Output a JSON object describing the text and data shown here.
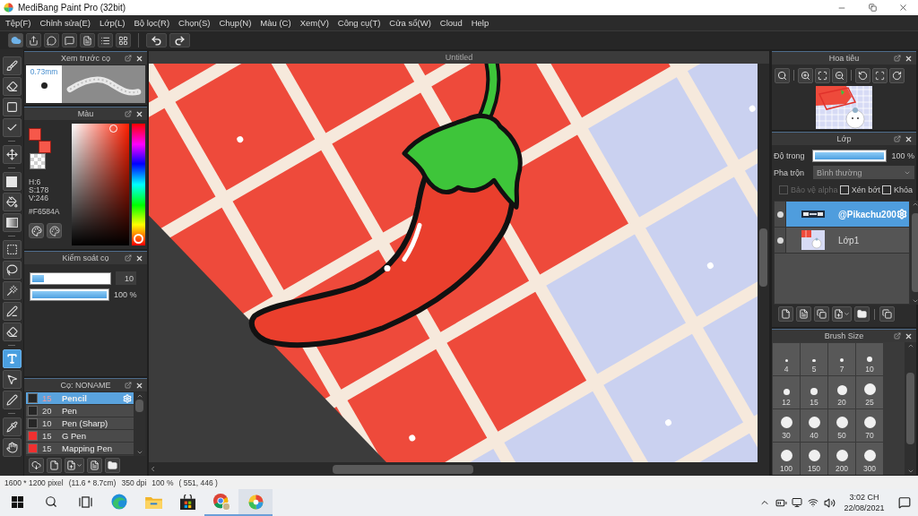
{
  "window": {
    "title": "MediBang Paint Pro (32bit)"
  },
  "menu": [
    "Tệp(F)",
    "Chỉnh sửa(E)",
    "Lớp(L)",
    "Bộ lọc(R)",
    "Chọn(S)",
    "Chụp(N)",
    "Màu (C)",
    "Xem(V)",
    "Công cụ(T)",
    "Cửa sổ(W)",
    "Cloud",
    "Help"
  ],
  "tool_groups": [
    {
      "tools": [
        {
          "selected": false
        },
        {
          "selected": false
        },
        {
          "selected": false
        },
        {
          "selected": false
        }
      ]
    },
    {
      "tools": [
        {
          "selected": false
        }
      ]
    },
    {
      "tools": [
        {
          "selected": false
        },
        {
          "selected": false
        },
        {
          "selected": false
        }
      ]
    },
    {
      "tools": [
        {
          "selected": false
        },
        {
          "selected": false
        },
        {
          "selected": false
        },
        {
          "selected": false
        },
        {
          "selected": false
        }
      ]
    },
    {
      "tools": [
        {
          "selected": true
        },
        {
          "selected": false
        },
        {
          "selected": false
        }
      ]
    },
    {
      "tools": [
        {
          "selected": false
        },
        {
          "selected": false
        }
      ]
    }
  ],
  "brush_preview": {
    "title": "Xem trước cọ",
    "size": "0.73mm"
  },
  "color_panel": {
    "title": "Màu",
    "swatches": [
      {
        "color": "#f6584a"
      },
      {
        "color": "#f6584a"
      }
    ],
    "hsv": [
      "H:6",
      "S:178",
      "V:246"
    ],
    "hex": "#F6584A",
    "hue": {
      "level": 0.02
    }
  },
  "brush_control": {
    "title": "Kiểm soát cọ",
    "sliders": [
      {
        "kind": "boxed",
        "level": 0.15,
        "reading": "10"
      },
      {
        "kind": "plain",
        "level": 1,
        "reading": "100 %"
      }
    ]
  },
  "brush_list": {
    "title": "Cọ: NONAME",
    "items": [
      {
        "color": "#262626",
        "size": "15",
        "name": "Pencil",
        "selected": true
      },
      {
        "color": "#262626",
        "size": "20",
        "name": "Pen",
        "selected": false
      },
      {
        "color": "#262626",
        "size": "10",
        "name": "Pen (Sharp)",
        "selected": false
      },
      {
        "color": "#f03030",
        "size": "15",
        "name": "G Pen",
        "selected": false
      },
      {
        "color": "#f03030",
        "size": "15",
        "name": "Mapping Pen",
        "selected": false
      }
    ]
  },
  "canvas": {
    "tab": "Untitled"
  },
  "navigator": {
    "title": "Hoa tiêu"
  },
  "layers": {
    "title": "Lớp",
    "opacity": {
      "label": "Độ trong",
      "level": 1,
      "reading": "100 %"
    },
    "blend": {
      "label": "Pha trộn",
      "value": "Bình thường"
    },
    "options": [
      {
        "label": "Bảo vệ alpha",
        "checked": false,
        "disabled": true
      },
      {
        "label": "Xén bớt",
        "checked": false,
        "disabled": false
      },
      {
        "label": "Khóa",
        "checked": false,
        "disabled": false
      }
    ],
    "items": [
      {
        "kind": "text",
        "name": "@Pikachu200",
        "selected": true,
        "visible": true
      },
      {
        "kind": "image",
        "name": "Lớp1",
        "selected": false,
        "visible": true
      }
    ]
  },
  "brush_size": {
    "title": "Brush Size",
    "sizes": [
      "4",
      "5",
      "7",
      "10",
      "12",
      "15",
      "20",
      "25",
      "30",
      "40",
      "50",
      "70",
      "100",
      "150",
      "200",
      "300"
    ]
  },
  "status_bar": [
    "1600 * 1200 pixel",
    "(11.6 * 8.7cm)",
    "350 dpi",
    "100 %",
    "( 551, 446 )"
  ],
  "taskbar": {
    "apps": [
      {
        "running": false,
        "selected": false
      },
      {
        "running": false,
        "selected": false
      },
      {
        "running": false,
        "selected": false
      },
      {
        "running": true,
        "selected": false
      },
      {
        "running": true,
        "selected": true
      }
    ],
    "time": "3:02 CH",
    "date": "22/08/2021"
  }
}
